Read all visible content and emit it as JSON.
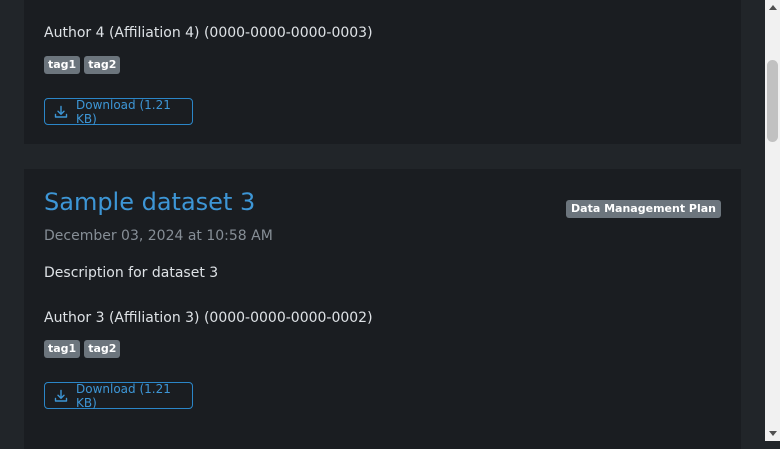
{
  "previous_card": {
    "author": "Author 4 (Affiliation 4) (0000-0000-0000-0003)",
    "tags": [
      "tag1",
      "tag2"
    ],
    "download_label": "Download (1.21 KB)"
  },
  "dataset_card": {
    "title": "Sample dataset 3",
    "badge": "Data Management Plan",
    "date": "December 03, 2024 at 10:58 AM",
    "description": "Description for dataset 3",
    "author": "Author 3 (Affiliation 3) (0000-0000-0000-0002)",
    "tags": [
      "tag1",
      "tag2"
    ],
    "download_label": "Download (1.21 KB)"
  },
  "icons": {
    "download": "download-icon",
    "scroll_up": "arrow-up-icon",
    "scroll_down": "arrow-down-icon"
  },
  "colors": {
    "page_bg": "#212529",
    "card_bg": "#1a1d21",
    "link": "#3d96d6",
    "tag_bg": "#6c757d",
    "muted_text": "#868e96"
  }
}
